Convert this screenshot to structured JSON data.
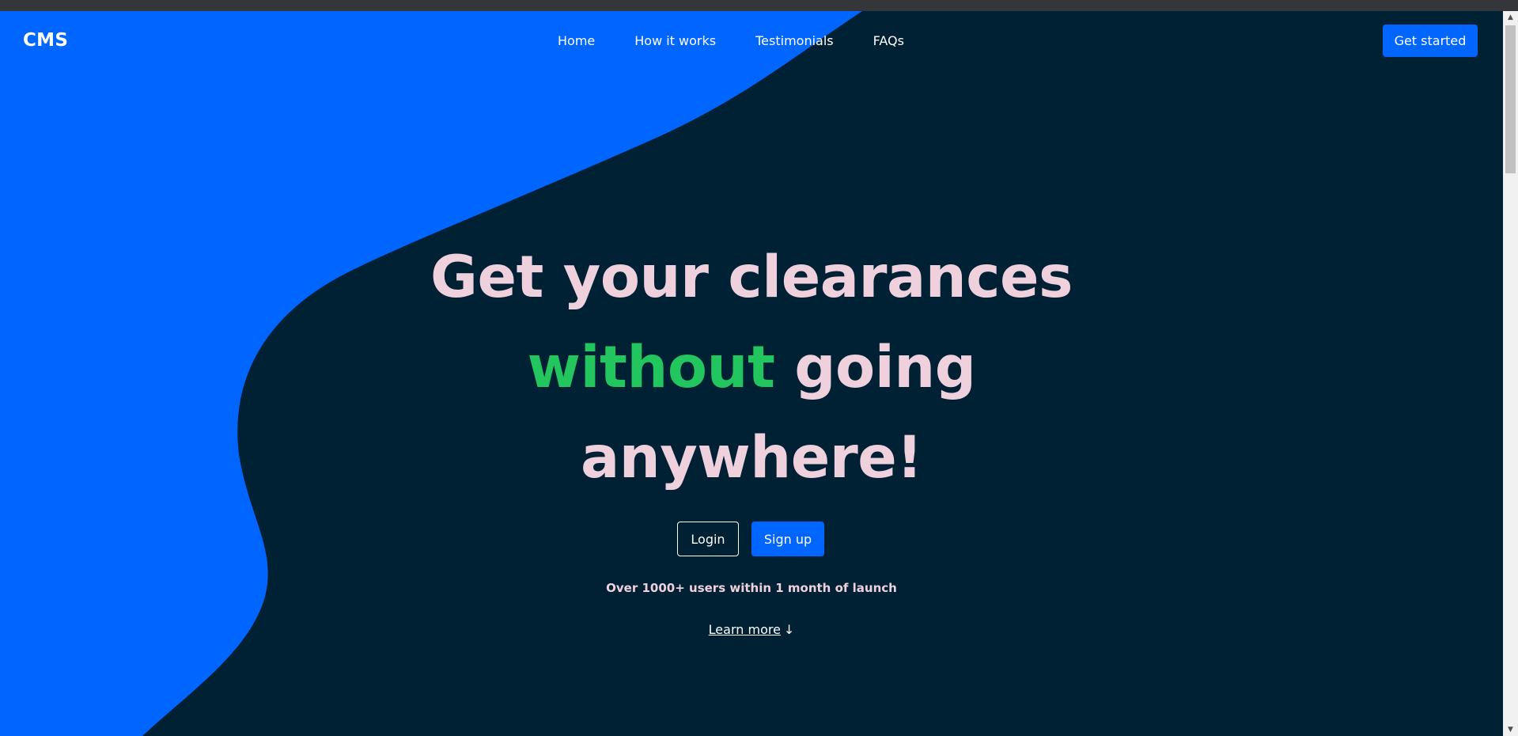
{
  "brand": {
    "name": "CMS"
  },
  "nav": {
    "links": [
      {
        "label": "Home"
      },
      {
        "label": "How it works"
      },
      {
        "label": "Testimonials"
      },
      {
        "label": "FAQs"
      }
    ],
    "cta_label": "Get started"
  },
  "hero": {
    "line1": "Get your clearances",
    "line2_accent": "without",
    "line2_rest": " going",
    "line3": "anywhere!",
    "login_label": "Login",
    "signup_label": "Sign up",
    "stat": "Over 1000+ users within 1 month of launch",
    "learn_more": "Learn more",
    "learn_more_arrow": "↓"
  },
  "colors": {
    "background": "#002033",
    "blue_accent": "#0066ff",
    "green_accent": "#22c55e",
    "headline_pink": "#efd1de"
  },
  "scrollbar": {
    "up_icon": "▲",
    "down_icon": "▼"
  }
}
